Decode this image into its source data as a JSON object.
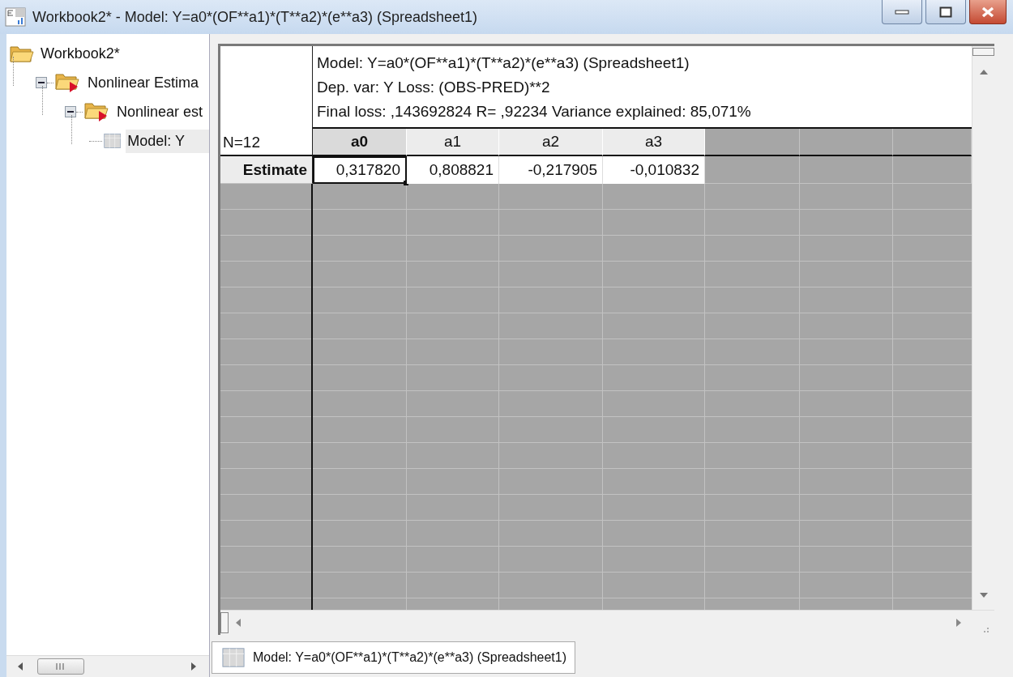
{
  "window": {
    "title": "Workbook2* - Model: Y=a0*(OF**a1)*(T**a2)*(e**a3) (Spreadsheet1)"
  },
  "tree": [
    {
      "label": "Workbook2*",
      "kind": "workbook",
      "selected": false,
      "children": [
        {
          "label": "Nonlinear Estima",
          "kind": "analysis",
          "selected": false,
          "expanded": true,
          "children": [
            {
              "label": "Nonlinear est",
              "kind": "analysis",
              "selected": false,
              "expanded": true,
              "children": [
                {
                  "label": "Model: Y",
                  "kind": "spreadsheet",
                  "selected": true
                }
              ]
            }
          ]
        }
      ]
    }
  ],
  "sheet": {
    "info": [
      "Model: Y=a0*(OF**a1)*(T**a2)*(e**a3) (Spreadsheet1)",
      "Dep. var: Y Loss: (OBS-PRED)**2",
      "Final loss: ,143692824 R= ,92234 Variance explained: 85,071%"
    ],
    "case_count": "N=12",
    "columns": [
      {
        "label": "a0",
        "selected": true
      },
      {
        "label": "a1",
        "selected": false
      },
      {
        "label": "a2",
        "selected": false
      },
      {
        "label": "a3",
        "selected": false
      }
    ],
    "rows": [
      {
        "label": "Estimate",
        "cells": [
          {
            "text": "0,317820",
            "selected": true
          },
          {
            "text": "0,808821",
            "selected": false
          },
          {
            "text": "-0,217905",
            "selected": false
          },
          {
            "text": "-0,010832",
            "selected": false
          }
        ]
      }
    ]
  },
  "bottom_tab": {
    "label": "Model: Y=a0*(OF**a1)*(T**a2)*(e**a3) (Spreadsheet1)"
  }
}
